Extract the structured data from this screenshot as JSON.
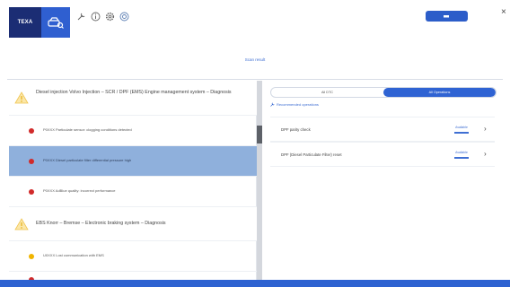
{
  "header": {
    "brand": "TEXA",
    "top_button_label": "",
    "close_glyph": "×"
  },
  "scan_result_label": "Scan result",
  "left_list": {
    "systems": [
      {
        "title": "Diesel injection Volvo Injection – SCR / DPF (EMS) Engine management system – Diagnosis",
        "dtcs": [
          {
            "text": "P0XXX Particulate sensor: clogging conditions detected",
            "color": "#d12a2a",
            "selected": false
          },
          {
            "text": "P0XXX Diesel particulate filter differential pressure high",
            "color": "#d12a2a",
            "selected": true
          },
          {
            "text": "P0XXX AdBlue quality: incorrect performance",
            "color": "#d12a2a",
            "selected": false
          }
        ]
      },
      {
        "title": "EBS Knorr – Bremse – Electronic braking system – Diagnosis",
        "dtcs": [
          {
            "text": "U0XXX Lost communication with EMS",
            "color": "#f0b400",
            "selected": false
          }
        ]
      }
    ]
  },
  "right_panel": {
    "tabs": [
      {
        "label": "All DTC",
        "active": false
      },
      {
        "label": "All Operations",
        "active": true
      }
    ],
    "recommended_label": "Recommended operations",
    "operations": [
      {
        "name": "DPF parity check",
        "status": "Available"
      },
      {
        "name": "DPF (Diesel Particulate Filter) reset",
        "status": "Available"
      }
    ]
  },
  "colors": {
    "brand_blue": "#1b2d74",
    "accent_blue": "#2f63d3",
    "selected_row": "#8fb0dc",
    "error_red": "#d12a2a",
    "warning_amber": "#f0b400"
  }
}
